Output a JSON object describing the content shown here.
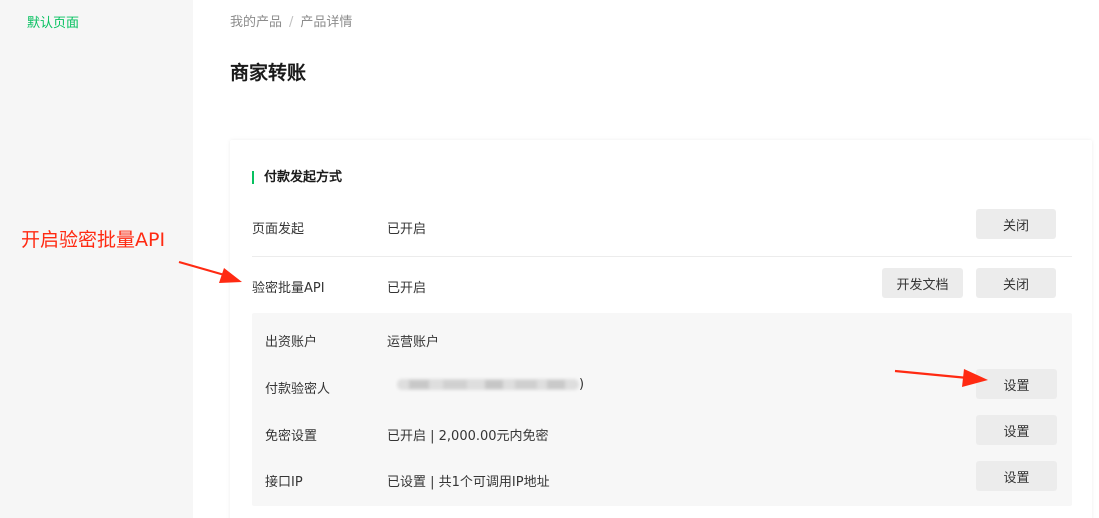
{
  "sidebar": {
    "items": [
      {
        "label": "默认页面"
      }
    ]
  },
  "breadcrumb": {
    "items": [
      "我的产品",
      "产品详情"
    ],
    "separator": "/"
  },
  "page": {
    "title": "商家转账"
  },
  "section": {
    "title": "付款发起方式",
    "rows": [
      {
        "label": "页面发起",
        "value": "已开启",
        "buttons": [
          "关闭"
        ]
      },
      {
        "label": "验密批量API",
        "value": "已开启",
        "buttons": [
          "开发文档",
          "关闭"
        ]
      }
    ],
    "details": [
      {
        "label": "出资账户",
        "value": "运营账户"
      },
      {
        "label": "付款验密人",
        "value_suffix": ")",
        "button": "设置"
      },
      {
        "label": "免密设置",
        "value": "已开启 | 2,000.00元内免密",
        "button": "设置"
      },
      {
        "label": "接口IP",
        "value": "已设置 | 共1个可调用IP地址",
        "button": "设置"
      }
    ]
  },
  "annotation": {
    "text": "开启验密批量API"
  },
  "colors": {
    "accent": "#07c160",
    "annotation": "#ff2a12"
  }
}
